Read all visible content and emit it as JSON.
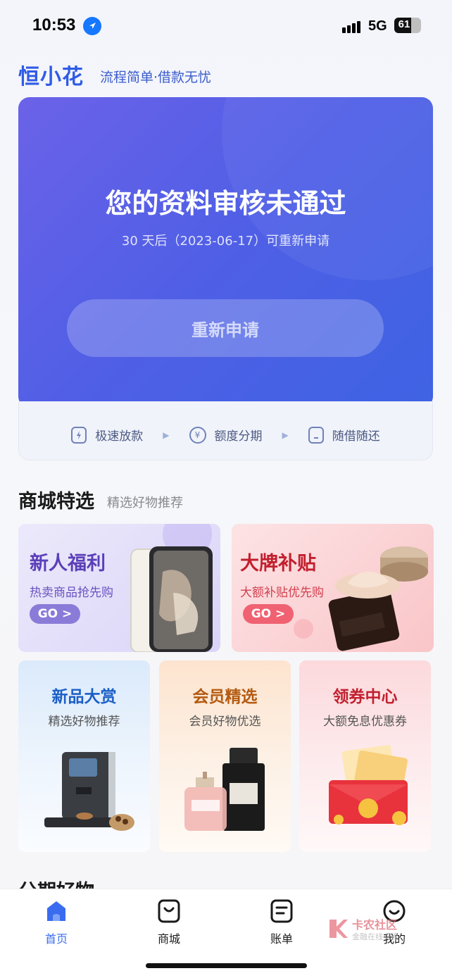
{
  "status_bar": {
    "time": "10:53",
    "network": "5G",
    "battery": "61"
  },
  "brand": {
    "logo": "恒小花",
    "slogan": "流程简单·借款无忧"
  },
  "hero": {
    "title": "您的资料审核未通过",
    "subtitle": "30 天后（2023-06-17）可重新申请",
    "button_label": "重新申请"
  },
  "features": [
    {
      "label": "极速放款",
      "icon": "shield-bolt-icon"
    },
    {
      "label": "额度分期",
      "icon": "yen-coin-icon"
    },
    {
      "label": "随借随还",
      "icon": "phone-icon"
    }
  ],
  "mall": {
    "title": "商城特选",
    "subtitle": "精选好物推荐"
  },
  "promo_cards": [
    {
      "title": "新人福利",
      "subtitle": "热卖商品抢先购",
      "cta": "GO >",
      "color": "#5b3fb8",
      "accent": "#8b7bd8"
    },
    {
      "title": "大牌补贴",
      "subtitle": "大额补贴优先购",
      "cta": "GO >",
      "color": "#c21f2e",
      "accent": "#f06272"
    }
  ],
  "small_cards": [
    {
      "title": "新品大赏",
      "subtitle": "精选好物推荐",
      "color": "#1a5fc6"
    },
    {
      "title": "会员精选",
      "subtitle": "会员好物优选",
      "color": "#b35a10"
    },
    {
      "title": "领券中心",
      "subtitle": "大额免息优惠券",
      "color": "#c2202f"
    }
  ],
  "next_section_title": "分期好物",
  "tabbar": [
    {
      "label": "首页",
      "icon": "home-icon",
      "active": true
    },
    {
      "label": "商城",
      "icon": "shop-bag-icon",
      "active": false
    },
    {
      "label": "账单",
      "icon": "bill-icon",
      "active": false
    },
    {
      "label": "我的",
      "icon": "smile-icon",
      "active": false
    }
  ],
  "watermark": {
    "title": "卡农社区",
    "subtitle": "金融在线交流"
  },
  "colors": {
    "primary": "#4f5fe6",
    "tab_active": "#3a6cf0"
  }
}
